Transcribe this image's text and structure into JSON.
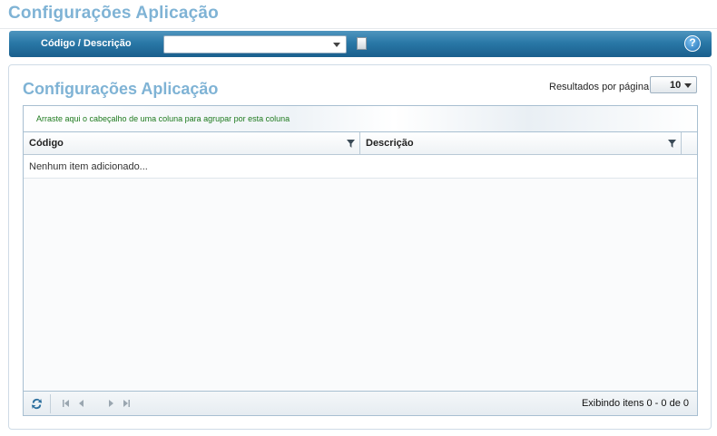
{
  "page": {
    "title": "Configurações Aplicação"
  },
  "filter_bar": {
    "label": "Código / Descrição",
    "combo_value": "",
    "help_glyph": "?"
  },
  "panel": {
    "title": "Configurações Aplicação",
    "results_per_page_label": "Resultados por página",
    "results_per_page_value": "10"
  },
  "grid": {
    "group_hint": "Arraste aqui o cabeçalho de uma coluna para agrupar por esta coluna",
    "columns": [
      {
        "label": "Código"
      },
      {
        "label": "Descrição"
      }
    ],
    "empty_message": "Nenhum item adicionado...",
    "pager_info": "Exibindo itens 0 - 0 de 0"
  },
  "icons": {
    "combo_arrow": "chevron-down-icon",
    "doc": "document-icon",
    "help": "help-icon",
    "filter": "filter-icon",
    "refresh": "refresh-icon",
    "first": "first-page-icon",
    "prev": "previous-page-icon",
    "next": "next-page-icon",
    "last": "last-page-icon"
  },
  "colors": {
    "title": "#7fb3d5",
    "bar": "#2a78a7",
    "group_hint": "#1e7a1e"
  }
}
